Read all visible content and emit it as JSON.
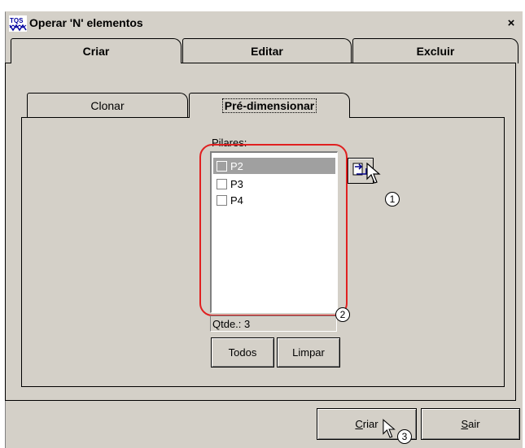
{
  "window": {
    "title": "Operar 'N' elementos",
    "app_icon_text": "TQS",
    "close_glyph": "×"
  },
  "outer_tabs": [
    {
      "label": "Criar",
      "active": true
    },
    {
      "label": "Editar",
      "active": false
    },
    {
      "label": "Excluir",
      "active": false
    }
  ],
  "inner_tabs": [
    {
      "label": "Clonar",
      "active": false
    },
    {
      "label": "Pré-dimensionar",
      "active": true
    }
  ],
  "pilares": {
    "label": "Pilares:",
    "items": [
      {
        "label": "P2",
        "checked": false,
        "selected": true
      },
      {
        "label": "P3",
        "checked": false,
        "selected": false
      },
      {
        "label": "P4",
        "checked": false,
        "selected": false
      }
    ],
    "qtde": "Qtde.: 3"
  },
  "buttons": {
    "todos": "Todos",
    "limpar": "Limpar",
    "criar_first": "C",
    "criar_rest": "riar",
    "sair_first": "S",
    "sair_rest": "air"
  },
  "annotations": {
    "step1": "1",
    "step2": "2",
    "step3": "3",
    "highlight_color": "#e02020"
  },
  "icons": [
    "tqs-app-icon",
    "close-icon",
    "transfer-icon",
    "mouse-cursor-icon"
  ]
}
